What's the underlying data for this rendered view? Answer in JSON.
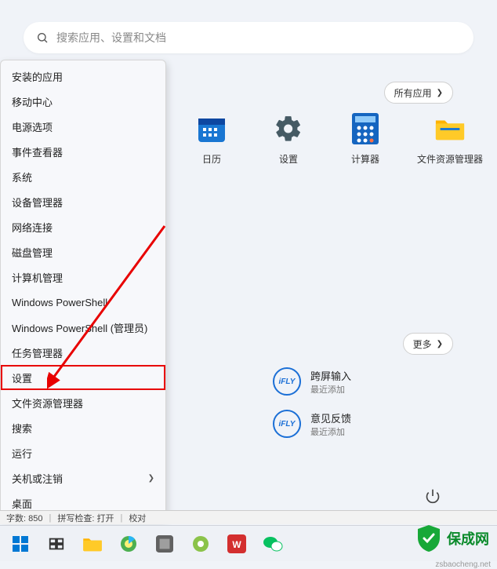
{
  "search": {
    "placeholder": "搜索应用、设置和文档"
  },
  "context_menu": {
    "items": [
      {
        "label": "安装的应用"
      },
      {
        "label": "移动中心"
      },
      {
        "label": "电源选项"
      },
      {
        "label": "事件查看器"
      },
      {
        "label": "系统"
      },
      {
        "label": "设备管理器"
      },
      {
        "label": "网络连接"
      },
      {
        "label": "磁盘管理"
      },
      {
        "label": "计算机管理"
      },
      {
        "label": "Windows PowerShell"
      },
      {
        "label": "Windows PowerShell (管理员)"
      },
      {
        "label": "任务管理器"
      },
      {
        "label": "设置"
      },
      {
        "label": "文件资源管理器"
      },
      {
        "label": "搜索"
      },
      {
        "label": "运行"
      },
      {
        "label": "关机或注销",
        "submenu": true
      },
      {
        "label": "桌面"
      }
    ],
    "highlight_index": 12
  },
  "pills": {
    "all_apps": "所有应用",
    "more": "更多"
  },
  "pinned": [
    {
      "label": "日历",
      "key": "calendar"
    },
    {
      "label": "设置",
      "key": "settings"
    },
    {
      "label": "计算器",
      "key": "calculator"
    },
    {
      "label": "文件资源管理器",
      "key": "file-explorer"
    }
  ],
  "recommended": [
    {
      "title": "跨屏输入",
      "sub": "最近添加",
      "badge": "iFLY"
    },
    {
      "title": "意见反馈",
      "sub": "最近添加",
      "badge": "iFLY"
    }
  ],
  "statusbar": {
    "a": "字数: 850",
    "b": "拼写检查: 打开",
    "c": "校对"
  },
  "brand": {
    "text": "保成网",
    "url_hint": "zsbaocheng.net"
  }
}
